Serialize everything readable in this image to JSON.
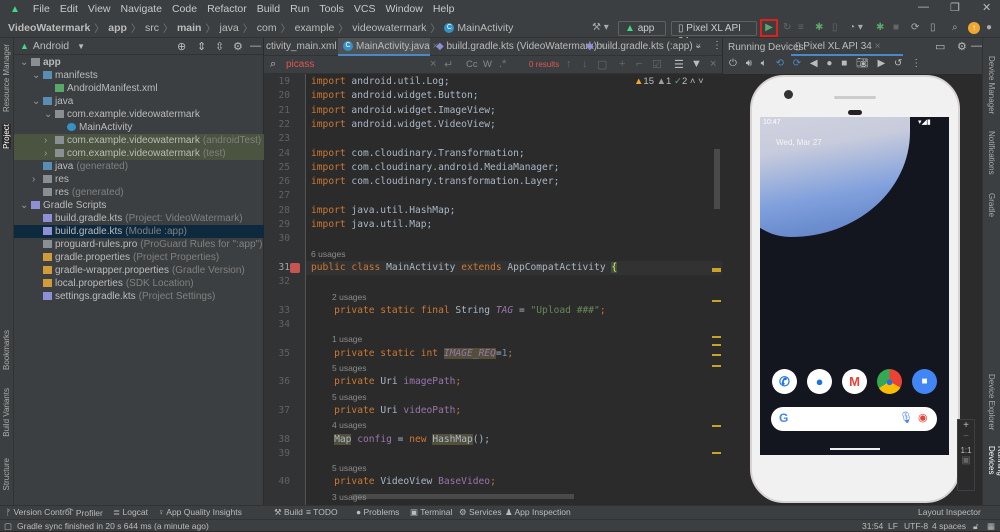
{
  "menu": {
    "items": [
      "File",
      "Edit",
      "View",
      "Navigate",
      "Code",
      "Refactor",
      "Build",
      "Run",
      "Tools",
      "VCS",
      "Window",
      "Help"
    ]
  },
  "breadcrumb": [
    "VideoWatermark",
    "app",
    "src",
    "main",
    "java",
    "com",
    "example",
    "videowatermark",
    "MainActivity"
  ],
  "toolbar": {
    "config": "app",
    "device": "Pixel XL API 34",
    "run_tooltip": "Run"
  },
  "colors": {
    "accent": "#4a88c7",
    "run_highlight": "#e0201b",
    "android_green": "#3ddc84"
  },
  "project": {
    "view": "Android",
    "tree": [
      {
        "label": "app",
        "hint": "",
        "indent": 0,
        "arrow": "v",
        "icon": "module",
        "bold": true
      },
      {
        "label": "manifests",
        "hint": "",
        "indent": 1,
        "arrow": "v",
        "icon": "folder"
      },
      {
        "label": "AndroidManifest.xml",
        "hint": "",
        "indent": 2,
        "arrow": "",
        "icon": "xml"
      },
      {
        "label": "java",
        "hint": "",
        "indent": 1,
        "arrow": "v",
        "icon": "folder"
      },
      {
        "label": "com.example.videowatermark",
        "hint": "",
        "indent": 2,
        "arrow": "v",
        "icon": "package"
      },
      {
        "label": "MainActivity",
        "hint": "",
        "indent": 3,
        "arrow": "",
        "icon": "class"
      },
      {
        "label": "com.example.videowatermark",
        "hint": "(androidTest)",
        "indent": 2,
        "arrow": ">",
        "icon": "package",
        "green": true
      },
      {
        "label": "com.example.videowatermark",
        "hint": "(test)",
        "indent": 2,
        "arrow": ">",
        "icon": "package",
        "green": true
      },
      {
        "label": "java",
        "hint": "(generated)",
        "indent": 1,
        "arrow": "",
        "icon": "folder-gen"
      },
      {
        "label": "res",
        "hint": "",
        "indent": 1,
        "arrow": ">",
        "icon": "res"
      },
      {
        "label": "res",
        "hint": "(generated)",
        "indent": 1,
        "arrow": "",
        "icon": "res"
      },
      {
        "label": "Gradle Scripts",
        "hint": "",
        "indent": 0,
        "arrow": "v",
        "icon": "gradle"
      },
      {
        "label": "build.gradle.kts",
        "hint": "(Project: VideoWatermark)",
        "indent": 1,
        "arrow": "",
        "icon": "gradle"
      },
      {
        "label": "build.gradle.kts",
        "hint": "(Module :app)",
        "indent": 1,
        "arrow": "",
        "icon": "gradle",
        "selected": true
      },
      {
        "label": "proguard-rules.pro",
        "hint": "(ProGuard Rules for \":app\")",
        "indent": 1,
        "arrow": "",
        "icon": "file"
      },
      {
        "label": "gradle.properties",
        "hint": "(Project Properties)",
        "indent": 1,
        "arrow": "",
        "icon": "props"
      },
      {
        "label": "gradle-wrapper.properties",
        "hint": "(Gradle Version)",
        "indent": 1,
        "arrow": "",
        "icon": "props"
      },
      {
        "label": "local.properties",
        "hint": "(SDK Location)",
        "indent": 1,
        "arrow": "",
        "icon": "props"
      },
      {
        "label": "settings.gradle.kts",
        "hint": "(Project Settings)",
        "indent": 1,
        "arrow": "",
        "icon": "gradle"
      }
    ]
  },
  "left_stripe": [
    "Resource Manager",
    "Project",
    "Bookmarks",
    "Build Variants",
    "Structure"
  ],
  "right_stripe": [
    "Device Manager",
    "Notifications",
    "Gradle",
    "Device Explorer",
    "Running Devices"
  ],
  "tabs": [
    "ctivity_main.xml",
    "MainActivity.java",
    "build.gradle.kts (VideoWatermark)",
    "build.gradle.kts (:app)"
  ],
  "search": {
    "query": "picass",
    "results": "0 results",
    "options": [
      "Cc",
      "W"
    ]
  },
  "inspections": {
    "warnings": "15",
    "weak_warnings": "1",
    "typos": "2"
  },
  "code": [
    {
      "ln": "19",
      "tokens": [
        [
          "import",
          "k"
        ],
        [
          " android.util.Log;",
          "t"
        ]
      ]
    },
    {
      "ln": "20",
      "tokens": [
        [
          "import",
          "k"
        ],
        [
          " android.widget.Button;",
          "t"
        ]
      ]
    },
    {
      "ln": "21",
      "tokens": [
        [
          "import",
          "k"
        ],
        [
          " android.widget.ImageView;",
          "t"
        ]
      ]
    },
    {
      "ln": "22",
      "tokens": [
        [
          "import",
          "k"
        ],
        [
          " android.widget.VideoView;",
          "t"
        ]
      ]
    },
    {
      "ln": "23",
      "tokens": []
    },
    {
      "ln": "24",
      "tokens": [
        [
          "import",
          "k"
        ],
        [
          " com.cloudinary.Transformation;",
          "t"
        ]
      ]
    },
    {
      "ln": "25",
      "tokens": [
        [
          "import",
          "k"
        ],
        [
          " com.cloudinary.android.MediaManager;",
          "t"
        ]
      ]
    },
    {
      "ln": "26",
      "tokens": [
        [
          "import",
          "k"
        ],
        [
          " com.cloudinary.transformation.Layer;",
          "t"
        ]
      ]
    },
    {
      "ln": "27",
      "tokens": []
    },
    {
      "ln": "28",
      "tokens": [
        [
          "import",
          "k"
        ],
        [
          " java.util.HashMap;",
          "t"
        ]
      ]
    },
    {
      "ln": "29",
      "tokens": [
        [
          "import",
          "k"
        ],
        [
          " java.util.Map;",
          "t"
        ]
      ]
    },
    {
      "ln": "30",
      "tokens": []
    },
    {
      "usage": "6 usages"
    },
    {
      "ln": "31",
      "cur": true,
      "tokens": [
        [
          "public class ",
          "k"
        ],
        [
          "MainActivity ",
          "t"
        ],
        [
          "extends ",
          "k"
        ],
        [
          "AppCompatActivity ",
          "t"
        ],
        [
          "{",
          "br"
        ]
      ]
    },
    {
      "ln": "32",
      "tokens": []
    },
    {
      "usage": "2 usages",
      "indent": true
    },
    {
      "ln": "33",
      "tokens": [
        [
          "    private static final ",
          "k"
        ],
        [
          "String ",
          "t"
        ],
        [
          "TAG",
          "fi2"
        ],
        [
          " = ",
          "t"
        ],
        [
          "\"Upload ###\"",
          "s"
        ],
        [
          ";",
          "k"
        ]
      ]
    },
    {
      "ln": "34",
      "tokens": []
    },
    {
      "usage": "1 usage",
      "indent": true
    },
    {
      "ln": "35",
      "tokens": [
        [
          "    private static int ",
          "k"
        ],
        [
          "IMAGE_REQ",
          "fi"
        ],
        [
          "=",
          "t"
        ],
        [
          "1",
          "n"
        ],
        [
          ";",
          "k"
        ]
      ]
    },
    {
      "usage": "5 usages",
      "indent": true
    },
    {
      "ln": "36",
      "tokens": [
        [
          "    private ",
          "k"
        ],
        [
          "Uri ",
          "t"
        ],
        [
          "imagePath",
          "f"
        ],
        [
          ";",
          "k"
        ]
      ]
    },
    {
      "usage": "5 usages",
      "indent": true
    },
    {
      "ln": "37",
      "tokens": [
        [
          "    private ",
          "k"
        ],
        [
          "Uri ",
          "t"
        ],
        [
          "videoPath",
          "f"
        ],
        [
          ";",
          "k"
        ]
      ]
    },
    {
      "usage": "4 usages",
      "indent": true
    },
    {
      "ln": "38",
      "tokens": [
        [
          "    ",
          "t"
        ],
        [
          "Map",
          "hl"
        ],
        [
          " ",
          "t"
        ],
        [
          "config",
          "f"
        ],
        [
          " = ",
          "t"
        ],
        [
          "new ",
          "k"
        ],
        [
          "HashMap",
          "hl"
        ],
        [
          "();",
          "t"
        ]
      ]
    },
    {
      "ln": "39",
      "tokens": []
    },
    {
      "usage": "5 usages",
      "indent": true
    },
    {
      "ln": "40",
      "tokens": [
        [
          "    private ",
          "k"
        ],
        [
          "VideoView ",
          "t"
        ],
        [
          "BaseVideo",
          "f"
        ],
        [
          ";",
          "k"
        ]
      ]
    },
    {
      "usage": "3 usages",
      "indent": true
    }
  ],
  "running_devices": {
    "label": "Running Devices:",
    "tab": "Pixel XL API 34"
  },
  "phone": {
    "time": "10:47",
    "date": "Wed, Mar 27",
    "zoom_actual": "1:1"
  },
  "bottom_tools": [
    "Version Control",
    "Profiler",
    "Logcat",
    "App Quality Insights",
    "Build",
    "TODO",
    "Problems",
    "Terminal",
    "Services",
    "App Inspection"
  ],
  "layout_inspector": "Layout Inspector",
  "status": {
    "message": "Gradle sync finished in 20 s 644 ms (a minute ago)",
    "position": "31:54",
    "line_sep": "LF",
    "encoding": "UTF-8",
    "indent": "4 spaces"
  }
}
